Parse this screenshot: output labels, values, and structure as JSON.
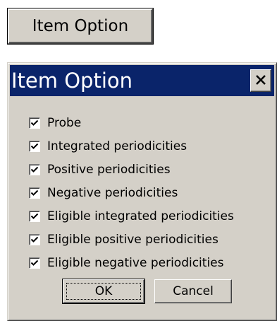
{
  "trigger_button": {
    "label": "Item Option"
  },
  "dialog": {
    "title": "Item Option",
    "close_glyph": "X",
    "options": [
      {
        "label": "Probe",
        "checked": true
      },
      {
        "label": "Integrated periodicities",
        "checked": true
      },
      {
        "label": "Positive periodicities",
        "checked": true
      },
      {
        "label": "Negative periodicities",
        "checked": true
      },
      {
        "label": "Eligible integrated periodicities",
        "checked": true
      },
      {
        "label": "Eligible positive periodicities",
        "checked": true
      },
      {
        "label": "Eligible negative periodicities",
        "checked": true
      }
    ],
    "ok_label": "OK",
    "cancel_label": "Cancel"
  },
  "colors": {
    "title_bar": "#0a246a",
    "face": "#d4d0c8",
    "title_text": "#ffffff"
  },
  "icons": {
    "close": "close-icon",
    "check": "checkmark-icon"
  }
}
